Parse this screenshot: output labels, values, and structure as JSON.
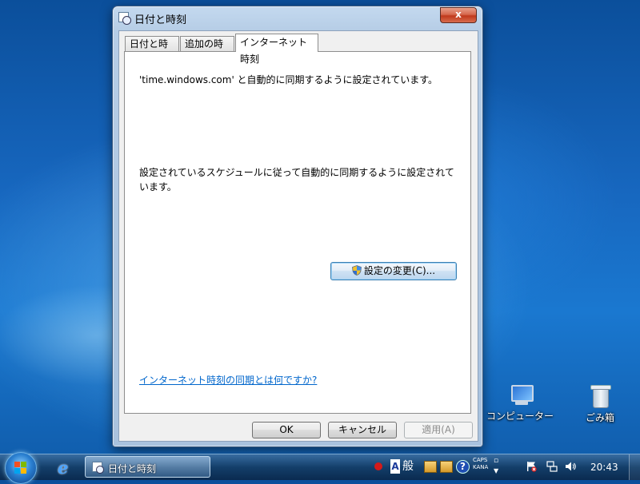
{
  "window": {
    "title": "日付と時刻",
    "close_label": "x"
  },
  "tabs": [
    {
      "label": "日付と時刻",
      "selected": false
    },
    {
      "label": "追加の時計",
      "selected": false
    },
    {
      "label": "インターネット時刻",
      "selected": true
    }
  ],
  "internet_time": {
    "sync_status": "'time.windows.com' と自動的に同期するように設定されています。",
    "schedule_text": "設定されているスケジュールに従って自動的に同期するように設定されています。",
    "change_settings_label": "設定の変更(C)...",
    "help_link": "インターネット時刻の同期とは何ですか?"
  },
  "dialog_buttons": {
    "ok": "OK",
    "cancel": "キャンセル",
    "apply": "適用(A)"
  },
  "desktop_icons": [
    {
      "label": "コンピューター",
      "icon": "computer-icon"
    },
    {
      "label": "ごみ箱",
      "icon": "recycle-bin-icon"
    }
  ],
  "taskbar": {
    "task_label": "日付と時刻",
    "ime_mode": "A",
    "ime_convert": "般",
    "ime_help": "?",
    "caps": "CAPS",
    "kana": "KANA",
    "clock": "20:43"
  },
  "colors": {
    "link": "#0066cc",
    "close_button": "#c0391c",
    "taskbar": "#143c64"
  }
}
